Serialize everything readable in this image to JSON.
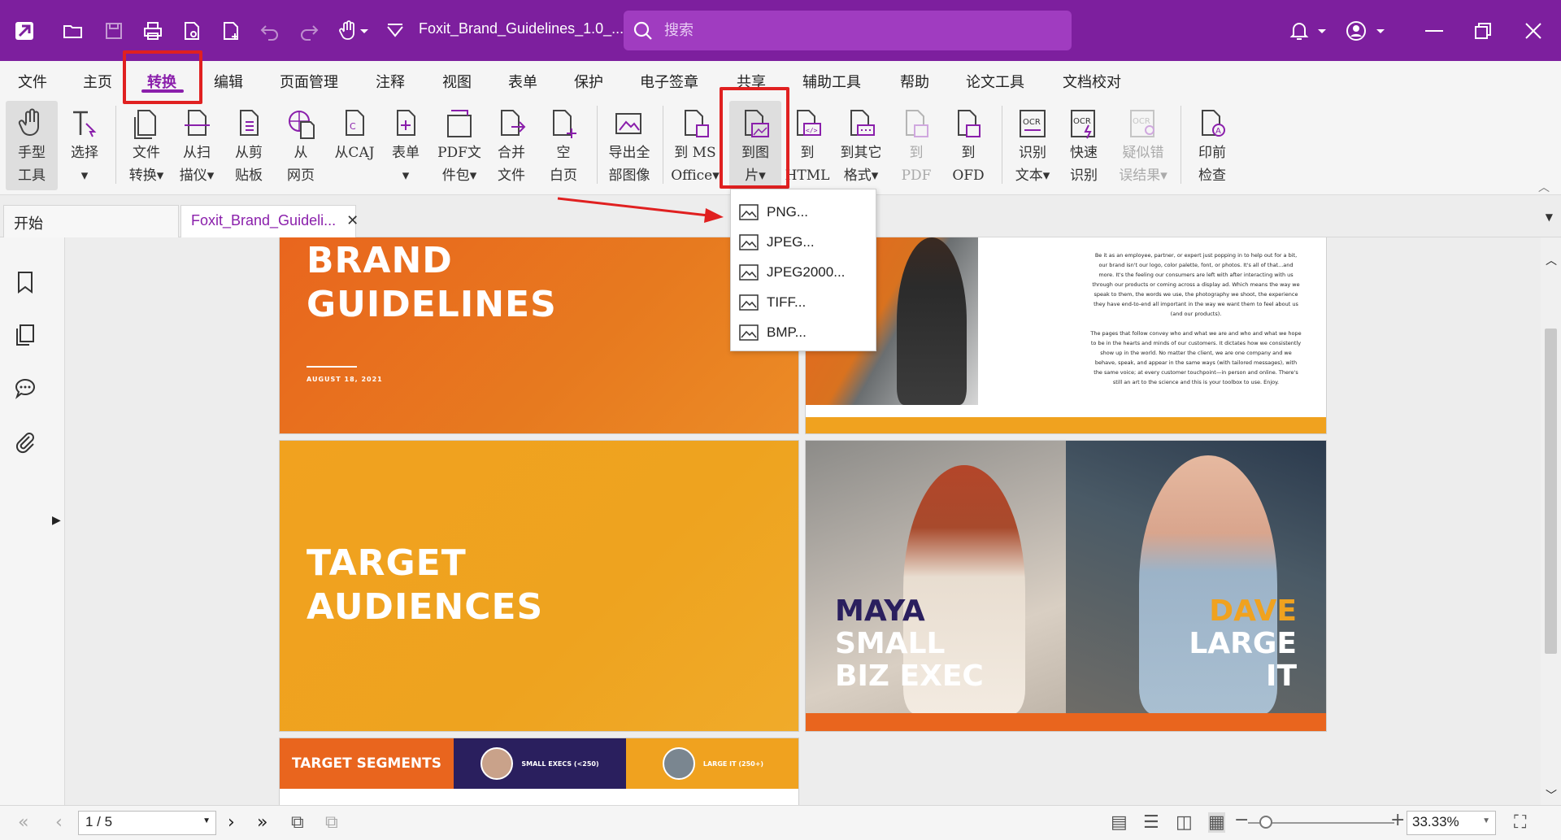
{
  "titlebar": {
    "doc_title": "Foxit_Brand_Guidelines_1.0_...",
    "search_placeholder": "搜索",
    "color": "#7d1f9e"
  },
  "menu": {
    "items": [
      "文件",
      "主页",
      "转换",
      "编辑",
      "页面管理",
      "注释",
      "视图",
      "表单",
      "保护",
      "电子签章",
      "共享",
      "辅助工具",
      "帮助",
      "论文工具",
      "文档校对"
    ],
    "active": "转换"
  },
  "ribbon": {
    "buttons": [
      {
        "label": "手型\n工具",
        "icon": "hand-icon"
      },
      {
        "label": "选择\n▾",
        "icon": "select-text-icon"
      },
      {
        "label": "文件\n转换▾",
        "icon": "file-convert-icon"
      },
      {
        "label": "从扫\n描仪▾",
        "icon": "scanner-icon"
      },
      {
        "label": "从剪\n贴板",
        "icon": "clipboard-icon"
      },
      {
        "label": "从\n网页",
        "icon": "web-page-icon"
      },
      {
        "label": "从CAJ",
        "icon": "caj-icon"
      },
      {
        "label": "表单\n▾",
        "icon": "form-icon"
      },
      {
        "label": "PDF文\n件包▾",
        "icon": "pdf-package-icon"
      },
      {
        "label": "合并\n文件",
        "icon": "merge-files-icon"
      },
      {
        "label": "空\n白页",
        "icon": "blank-page-icon"
      },
      {
        "label": "导出全\n部图像",
        "icon": "export-images-icon"
      },
      {
        "label": "到 MS\nOffice▾",
        "icon": "to-office-icon"
      },
      {
        "label": "到图\n片▾",
        "icon": "to-image-icon"
      },
      {
        "label": "到\nHTML",
        "icon": "to-html-icon"
      },
      {
        "label": "到其它\n格式▾",
        "icon": "to-other-format-icon"
      },
      {
        "label": "到\nPDF",
        "icon": "to-pdf-icon"
      },
      {
        "label": "到\nOFD",
        "icon": "to-ofd-icon"
      },
      {
        "label": "识别\n文本▾",
        "icon": "ocr-text-icon"
      },
      {
        "label": "快速\n识别",
        "icon": "ocr-quick-icon"
      },
      {
        "label": "疑似错\n误结果▾",
        "icon": "ocr-suspect-icon"
      },
      {
        "label": "印前\n检查",
        "icon": "preflight-icon"
      }
    ]
  },
  "tabs": [
    {
      "label": "开始"
    },
    {
      "label": "Foxit_Brand_Guideli...",
      "close": "✕"
    }
  ],
  "image_dropdown": {
    "items": [
      "PNG...",
      "JPEG...",
      "JPEG2000...",
      "TIFF...",
      "BMP..."
    ]
  },
  "pages": {
    "brand": {
      "title": "BRAND\nGUIDELINES",
      "date": "AUGUST 18, 2021"
    },
    "audiences": {
      "title": "TARGET\nAUDIENCES"
    },
    "intro_text": "Be it as an employee, partner, or expert just popping in to help out for a bit, our brand isn't our logo, color palette, font, or photos. It's all of that...and more. It's the feeling our consumers are left with after interacting with us through our products or coming across a display ad. Which means the way we speak to them, the words we use, the photography we shoot, the experience they have end-to-end all important in the way we want them to feel about us (and our products).\n\nThe pages that follow convey who and what we are and who and what we hope to be in the hearts and minds of our customers. It dictates how we consistently show up in the world. No matter the client, we are one company and we behave, speak, and appear in the same ways (with tailored messages), with the same voice; at every customer touchpoint—in person and online. There's still an art to the science and this is your toolbox to use. Enjoy.",
    "personas": {
      "maya": {
        "first": "MAYA",
        "rest": "SMALL\nBIZ EXEC"
      },
      "dave": {
        "first": "DAVE",
        "rest": "LARGE\nIT"
      }
    },
    "segments": {
      "title": "TARGET SEGMENTS",
      "small": "SMALL EXECS (<250)",
      "large": "LARGE IT (250+)"
    }
  },
  "statusbar": {
    "page_value": "1 / 5",
    "zoom_value": "33.33%",
    "zoom_level_fraction": 0.12
  },
  "colors": {
    "accent": "#8a1fab",
    "highlight_red": "#e02020",
    "orange": "#e9651e",
    "yellow": "#f1a21f",
    "navy": "#2a1f5e"
  }
}
